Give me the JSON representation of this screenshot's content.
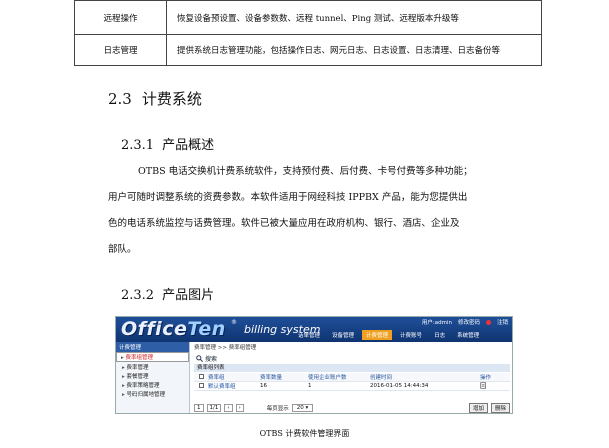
{
  "table": {
    "rows": [
      {
        "name": "远程操作",
        "desc": "恢复设备预设置、设备参数数、远程 tunnel、Ping 测试、远程版本升级等"
      },
      {
        "name": "日志管理",
        "desc": "提供系统日志管理功能，包括操作日志、网元日志、日志设置、日志清理、日志备份等"
      }
    ]
  },
  "section": {
    "num": "2.3",
    "title": "计费系统"
  },
  "sub1": {
    "num": "2.3.1",
    "title": "产品概述"
  },
  "para": {
    "lines": [
      "OTBS 电话交换机计费系统软件，支持预付费、后付费、卡号付费等多种功能；",
      "用户可随时调整系统的资费参数。本软件适用于网经科技 IPPBX 产品，能为您提供出",
      "色的电话系统监控与话费管理。软件已被大量应用在政府机构、银行、酒店、企业及",
      "部队。"
    ]
  },
  "sub2": {
    "num": "2.3.2",
    "title": "产品图片"
  },
  "shot": {
    "logo_a": "Office",
    "logo_b": "Ten",
    "reg": "®",
    "system": "billing system",
    "user": "用户:admin",
    "changepw": "修改密码",
    "logout": "注销",
    "menu": [
      "话单管理",
      "设备管理",
      "计费管理",
      "计费账号",
      "日志",
      "系统管理"
    ],
    "left": {
      "head": "计费管理",
      "items": [
        "费率组管理",
        "费率管理",
        "套餐管理",
        "费率策略管理",
        "号码归属地管理"
      ]
    },
    "crumb": "费率管理 >> 费率组管理",
    "search": "搜索",
    "list_title": "费率组列表",
    "headers": [
      "费率组",
      "费率数量",
      "使用企业账户数",
      "创建时间",
      "操作"
    ],
    "row": {
      "name": "默认费率组",
      "count": "16",
      "users": "1",
      "time": "2016-01-05 14:44:34"
    },
    "pager": {
      "first": "1",
      "total": "1/1",
      "per_label": "每页显示",
      "per_value": "20",
      "add": "增加",
      "del": "删除"
    }
  },
  "caption": "OTBS 计费软件管理界面"
}
